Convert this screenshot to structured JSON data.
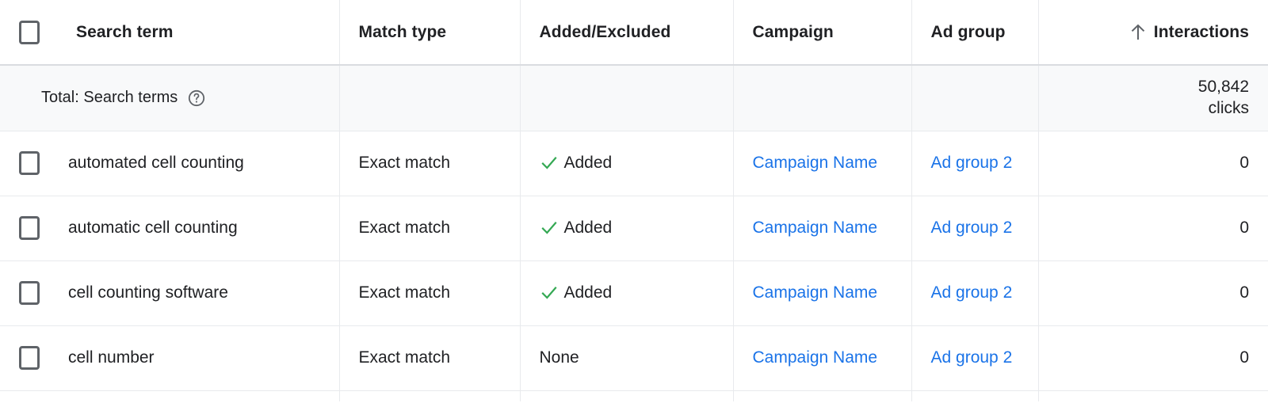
{
  "table": {
    "columns": [
      {
        "key": "search_term",
        "label": "Search term",
        "align": "left",
        "has_select_all_checkbox": true
      },
      {
        "key": "match_type",
        "label": "Match type",
        "align": "left"
      },
      {
        "key": "added_excluded",
        "label": "Added/Excluded",
        "align": "left"
      },
      {
        "key": "campaign",
        "label": "Campaign",
        "align": "left"
      },
      {
        "key": "ad_group",
        "label": "Ad group",
        "align": "left"
      },
      {
        "key": "interactions",
        "label": "Interactions",
        "align": "right",
        "sort": "ascending",
        "sort_icon": "arrow-up-icon"
      }
    ],
    "total_row": {
      "label": "Total: Search terms",
      "help_icon": "help-circle-icon",
      "match_type": "",
      "added_excluded": "",
      "campaign": "",
      "ad_group": "",
      "interactions_value": "50,842",
      "interactions_unit": "clicks"
    },
    "rows": [
      {
        "checkbox": "row-checkbox",
        "search_term": "automated cell counting",
        "match_type": "Exact match",
        "added_excluded": "Added",
        "added_excluded_icon": "check-icon",
        "campaign": "Campaign Name",
        "ad_group": "Ad group 2",
        "interactions": "0"
      },
      {
        "checkbox": "row-checkbox",
        "search_term": "automatic cell counting",
        "match_type": "Exact match",
        "added_excluded": "Added",
        "added_excluded_icon": "check-icon",
        "campaign": "Campaign Name",
        "ad_group": "Ad group 2",
        "interactions": "0"
      },
      {
        "checkbox": "row-checkbox",
        "search_term": "cell counting software",
        "match_type": "Exact match",
        "added_excluded": "Added",
        "added_excluded_icon": "check-icon",
        "campaign": "Campaign Name",
        "ad_group": "Ad group 2",
        "interactions": "0"
      },
      {
        "checkbox": "row-checkbox",
        "search_term": "cell number",
        "match_type": "Exact match",
        "added_excluded": "None",
        "added_excluded_icon": "",
        "campaign": "Campaign Name",
        "ad_group": "Ad group 2",
        "interactions": "0"
      }
    ]
  },
  "colors": {
    "link": "#1a73e8",
    "check_green": "#34a853",
    "text_primary": "#202124",
    "icon_gray": "#5f6368",
    "border": "#e8eaed",
    "header_border": "#dadce0",
    "total_row_bg": "#f8f9fa"
  }
}
